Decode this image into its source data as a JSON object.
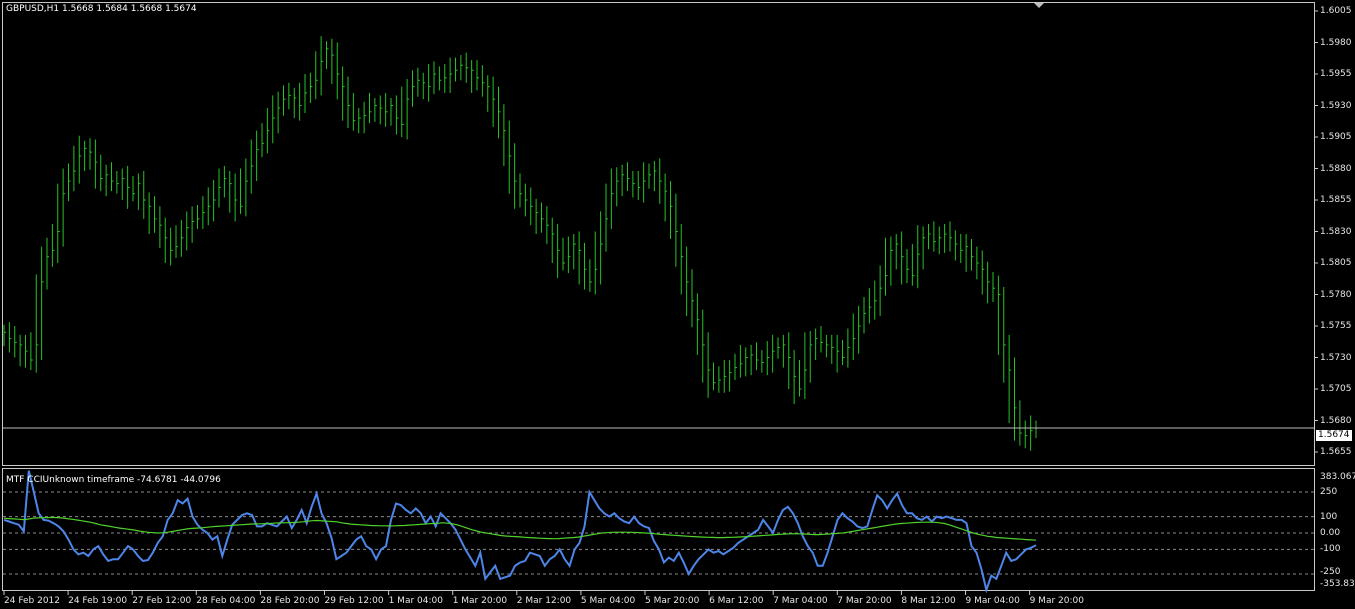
{
  "main_title": "GBPUSD,H1  1.5668 1.5684 1.5668 1.5674",
  "indicator_title": "MTF CCIUnknown timeframe -74.6781 -44.0796",
  "current_price_label": "1.5674",
  "colors": {
    "bars": "#26c226",
    "cci": "#4d86e8",
    "signal": "#4fd22b",
    "grid": "#c8c8c8"
  },
  "price_axis": [
    "1.6005",
    "1.5980",
    "1.5955",
    "1.5930",
    "1.5905",
    "1.5880",
    "1.5855",
    "1.5830",
    "1.5805",
    "1.5780",
    "1.5755",
    "1.5730",
    "1.5705",
    "1.5680",
    "1.5655"
  ],
  "cci_axis": [
    "383.0676",
    "250",
    "100",
    "0.00",
    "-100",
    "-250",
    "-353.834"
  ],
  "dates": [
    "24 Feb 2012",
    "24 Feb 19:00",
    "27 Feb 12:00",
    "28 Feb 04:00",
    "28 Feb 20:00",
    "29 Feb 12:00",
    "1 Mar 04:00",
    "1 Mar 20:00",
    "2 Mar 12:00",
    "5 Mar 04:00",
    "5 Mar 20:00",
    "6 Mar 12:00",
    "7 Mar 04:00",
    "7 Mar 20:00",
    "8 Mar 12:00",
    "9 Mar 04:00",
    "9 Mar 20:00"
  ],
  "chart_data": [
    {
      "type": "line",
      "title": "GBPUSD,H1  1.5668 1.5684 1.5668 1.5674",
      "ylim": [
        1.5645,
        1.601
      ],
      "series": [
        {
          "name": "GBPUSD",
          "values": [
            1.575,
            1.5745,
            1.5742,
            1.574,
            1.5735,
            1.5728,
            1.574,
            1.579,
            1.581,
            1.5815,
            1.583,
            1.586,
            1.587,
            1.5878,
            1.589,
            1.5896,
            1.5893,
            1.5885,
            1.5872,
            1.5875,
            1.587,
            1.5868,
            1.5872,
            1.5865,
            1.586,
            1.5868,
            1.5855,
            1.585,
            1.584,
            1.5835,
            1.5825,
            1.5815,
            1.5818,
            1.5825,
            1.5833,
            1.5838,
            1.584,
            1.5845,
            1.585,
            1.5855,
            1.5865,
            1.5872,
            1.5868,
            1.5855,
            1.585,
            1.587,
            1.5882,
            1.5895,
            1.59,
            1.591,
            1.592,
            1.5928,
            1.5935,
            1.5938,
            1.5936,
            1.593,
            1.594,
            1.5945,
            1.595,
            1.5965,
            1.5975,
            1.597,
            1.5955,
            1.5945,
            1.593,
            1.5918,
            1.592,
            1.5922,
            1.5925,
            1.593,
            1.5928,
            1.5925,
            1.593,
            1.592,
            1.5915,
            1.5935,
            1.5945,
            1.595,
            1.5948,
            1.5945,
            1.5955,
            1.595,
            1.5952,
            1.5955,
            1.5958,
            1.5962,
            1.596,
            1.5958,
            1.5952,
            1.5948,
            1.5945,
            1.5935,
            1.5925,
            1.591,
            1.589,
            1.587,
            1.586,
            1.5855,
            1.585,
            1.5845,
            1.584,
            1.5835,
            1.5828,
            1.5815,
            1.5805,
            1.581,
            1.582,
            1.5815,
            1.58,
            1.579,
            1.58,
            1.582,
            1.584,
            1.586,
            1.587,
            1.5875,
            1.5872,
            1.5868,
            1.5865,
            1.587,
            1.5875,
            1.5878,
            1.587,
            1.5862,
            1.585,
            1.583,
            1.581,
            1.579,
            1.5775,
            1.576,
            1.574,
            1.572,
            1.571,
            1.5712,
            1.5715,
            1.5718,
            1.5722,
            1.5725,
            1.573,
            1.5732,
            1.5728,
            1.5726,
            1.573,
            1.5735,
            1.5738,
            1.574,
            1.573,
            1.5715,
            1.5705,
            1.572,
            1.574,
            1.5745,
            1.5742,
            1.574,
            1.5738,
            1.5735,
            1.573,
            1.5738,
            1.5745,
            1.5755,
            1.5765,
            1.577,
            1.5775,
            1.5785,
            1.5795,
            1.5815,
            1.582,
            1.581,
            1.58,
            1.5795,
            1.5812,
            1.5825,
            1.5828,
            1.5822,
            1.5825,
            1.5828,
            1.5825,
            1.582,
            1.5815,
            1.5818,
            1.581,
            1.5805,
            1.58,
            1.579,
            1.5785,
            1.578,
            1.574,
            1.572,
            1.569,
            1.567,
            1.5668,
            1.5672,
            1.5674
          ]
        }
      ]
    },
    {
      "type": "line",
      "title": "MTF CCIUnknown timeframe -74.6781 -44.0796",
      "ylim": [
        -353.834,
        383.0676
      ],
      "series": [
        {
          "name": "",
          "values": [
            80,
            70,
            60,
            50,
            10,
            380,
            250,
            120,
            80,
            75,
            60,
            40,
            10,
            -40,
            -100,
            -130,
            -120,
            -140,
            -100,
            -80,
            -130,
            -170,
            -160,
            -160,
            -120,
            -80,
            -100,
            -140,
            -170,
            -165,
            -120,
            -60,
            -20,
            80,
            120,
            200,
            180,
            210,
            100,
            50,
            20,
            0,
            -40,
            -20,
            -140,
            -40,
            50,
            80,
            110,
            120,
            110,
            40,
            40,
            60,
            50,
            40,
            70,
            100,
            30,
            80,
            140,
            60,
            160,
            240,
            120,
            60,
            -30,
            -160,
            -140,
            -120,
            -80,
            -40,
            -20,
            -80,
            -100,
            -160,
            -100,
            -80,
            80,
            180,
            170,
            140,
            120,
            150,
            120,
            60,
            100,
            40,
            120,
            90,
            60,
            20,
            -40,
            -100,
            -150,
            -200,
            -120,
            -280,
            -240,
            -200,
            -280,
            -270,
            -260,
            -200,
            -180,
            -170,
            -120,
            -130,
            -140,
            -200,
            -160,
            -140,
            -100,
            -160,
            -200,
            -100,
            -60,
            40,
            250,
            200,
            150,
            120,
            100,
            120,
            90,
            70,
            60,
            100,
            60,
            40,
            30,
            -50,
            -100,
            -180,
            -150,
            -170,
            -120,
            -180,
            -250,
            -200,
            -160,
            -130,
            -100,
            -120,
            -110,
            -130,
            -110,
            -90,
            -60,
            -40,
            -20,
            0,
            20,
            80,
            40,
            0,
            80,
            140,
            160,
            120,
            60,
            -20,
            -80,
            -120,
            -200,
            -200,
            -120,
            -20,
            80,
            120,
            90,
            70,
            40,
            30,
            40,
            140,
            230,
            200,
            150,
            200,
            240,
            170,
            120,
            120,
            90,
            80,
            100,
            70,
            100,
            90,
            100,
            90,
            80,
            80,
            60,
            -80,
            -120,
            -220,
            -350,
            -260,
            -280,
            -200,
            -120,
            -170,
            -160,
            -130,
            -100,
            -90,
            -74.6781
          ]
        },
        {
          "name": "",
          "values": [
            90,
            88,
            86,
            84,
            82,
            85,
            90,
            92,
            93,
            94,
            95,
            94,
            92,
            88,
            84,
            80,
            75,
            70,
            65,
            58,
            50,
            45,
            40,
            35,
            30,
            26,
            22,
            18,
            12,
            8,
            4,
            2,
            0,
            2,
            5,
            10,
            15,
            20,
            25,
            28,
            30,
            32,
            35,
            38,
            40,
            42,
            44,
            46,
            48,
            50,
            52,
            54,
            55,
            56,
            57,
            58,
            60,
            62,
            62,
            63,
            64,
            66,
            68,
            72,
            75,
            76,
            74,
            72,
            70,
            68,
            62,
            58,
            54,
            52,
            50,
            48,
            46,
            45,
            44,
            44,
            43,
            44,
            45,
            46,
            48,
            50,
            52,
            54,
            56,
            58,
            60,
            62,
            60,
            56,
            50,
            40,
            30,
            20,
            12,
            5,
            0,
            -5,
            -10,
            -15,
            -18,
            -20,
            -22,
            -24,
            -26,
            -28,
            -30,
            -32,
            -33,
            -34,
            -35,
            -34,
            -32,
            -30,
            -28,
            -25,
            -20,
            -15,
            -10,
            -5,
            0,
            2,
            4,
            5,
            5,
            5,
            4,
            3,
            2,
            0,
            -2,
            -5,
            -8,
            -10,
            -12,
            -14,
            -16,
            -18,
            -20,
            -22,
            -24,
            -25,
            -26,
            -27,
            -28,
            -28,
            -27,
            -26,
            -25,
            -24,
            -22,
            -20,
            -18,
            -16,
            -14,
            -12,
            -10,
            -8,
            -6,
            -5,
            -4,
            -5,
            -6,
            -8,
            -10,
            -10,
            -8,
            -6,
            -4,
            -2,
            0,
            5,
            10,
            15,
            20,
            25,
            30,
            35,
            40,
            45,
            50,
            55,
            58,
            60,
            62,
            64,
            65,
            66,
            66,
            65,
            62,
            58,
            50,
            40,
            30,
            20,
            10,
            0,
            -8,
            -14,
            -20,
            -24,
            -28,
            -30,
            -32,
            -34,
            -36,
            -38,
            -40,
            -42,
            -44.0796
          ]
        }
      ]
    }
  ]
}
